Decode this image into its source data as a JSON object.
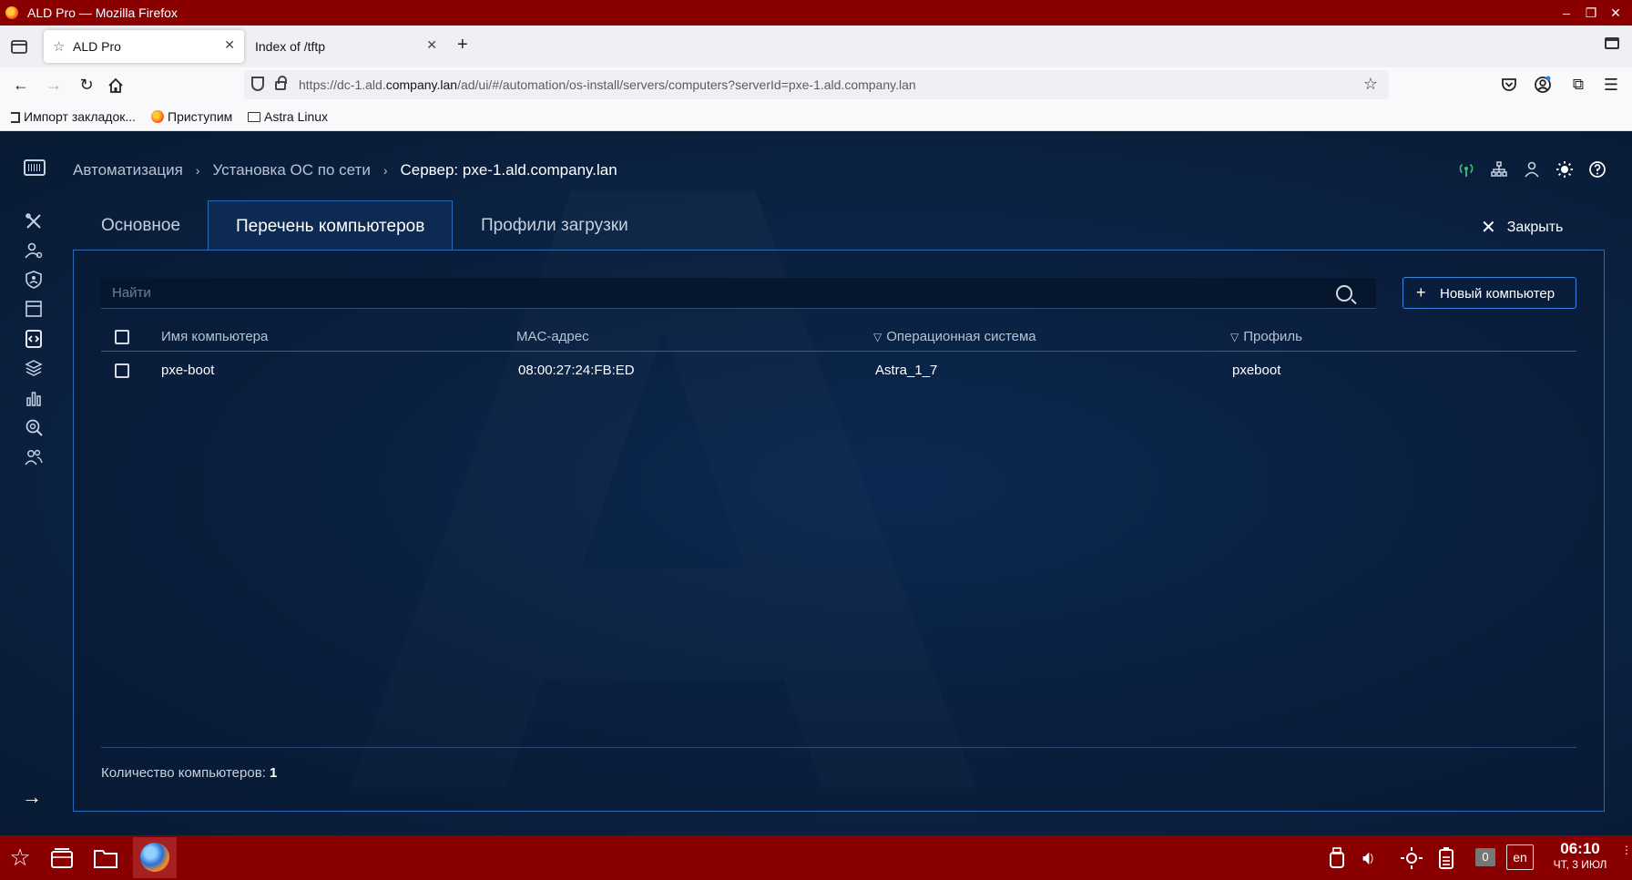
{
  "window": {
    "title": "ALD Pro — Mozilla Firefox"
  },
  "browser": {
    "tabs": [
      {
        "label": "ALD Pro",
        "active": true
      },
      {
        "label": "Index of /tftp",
        "active": false
      }
    ],
    "url_prefix": "https://dc-1.ald.",
    "url_host": "company.lan",
    "url_suffix": "/ad/ui/#/automation/os-install/servers/computers?serverId=pxe-1.ald.company.lan",
    "bookmarks": [
      {
        "label": "Импорт закладок...",
        "icon": "import-icon"
      },
      {
        "label": "Приступим",
        "icon": "firefox-icon"
      },
      {
        "label": "Astra Linux",
        "icon": "folder-icon"
      }
    ]
  },
  "app": {
    "breadcrumb": [
      "Автоматизация",
      "Установка ОС по сети",
      "Сервер: pxe-1.ald.company.lan"
    ],
    "tabs": [
      "Основное",
      "Перечень компьютеров",
      "Профили загрузки"
    ],
    "active_tab": 1,
    "close_label": "Закрыть",
    "search_placeholder": "Найти",
    "new_button_label": "Новый компьютер",
    "table": {
      "columns": [
        "Имя компьютера",
        "MAC-адрес",
        "Операционная система",
        "Профиль"
      ],
      "rows": [
        {
          "name": "pxe-boot",
          "mac": "08:00:27:24:FB:ED",
          "os": "Astra_1_7",
          "profile": "pxeboot"
        }
      ]
    },
    "footer_label": "Количество компьютеров: ",
    "footer_count": "1",
    "status_color": "#3cc46a",
    "accent_color": "#2a6bb8"
  },
  "taskbar": {
    "zero_indicator": "0",
    "layout": "en",
    "time": "06:10",
    "date": "ЧТ, 3 ИЮЛ"
  }
}
